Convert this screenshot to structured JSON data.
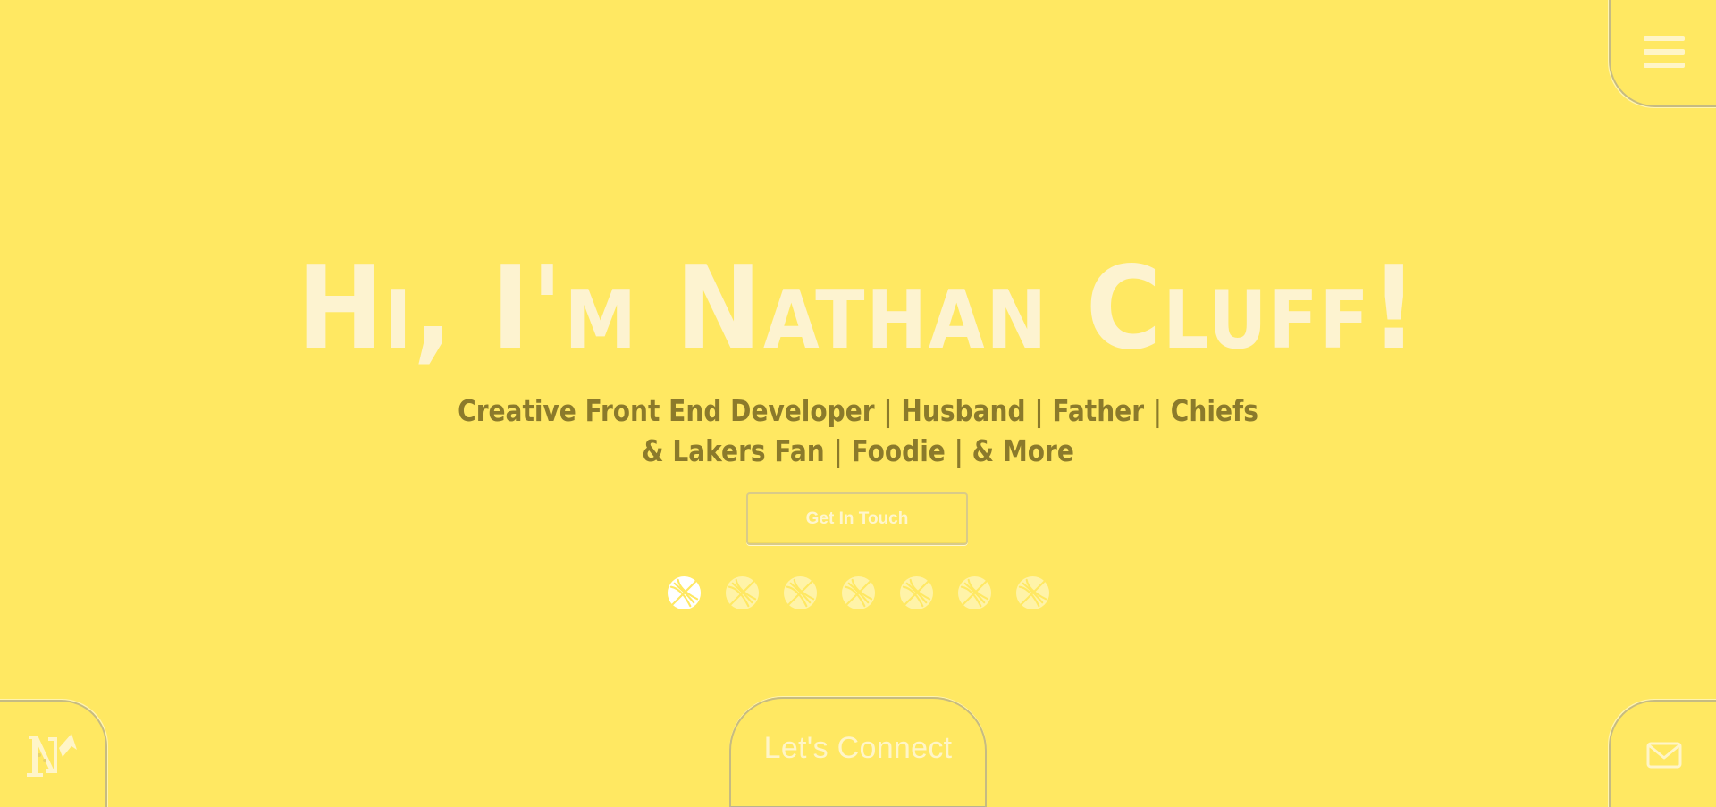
{
  "hero": {
    "title": "Hi, I'm Nathan Cluff!",
    "tagline_line1": "Creative Front End Developer | Husband | Father | Chiefs",
    "tagline_line2": "& Lakers Fan | Foodie | & More",
    "cta_label": "Get In Touch"
  },
  "carousel": {
    "dot_count": 7,
    "active_index": 0
  },
  "nav": {
    "menu_icon": "hamburger-menu-icon",
    "logo_icon": "nc-logo-icon",
    "mail_icon": "mail-icon",
    "connect_label": "Let's Connect"
  },
  "colors": {
    "background": "#FFE862",
    "title": "#FDF3D0",
    "tagline": "#8B7A2B",
    "accent_light": "#FFF5C8",
    "border": "#C6BB82"
  }
}
